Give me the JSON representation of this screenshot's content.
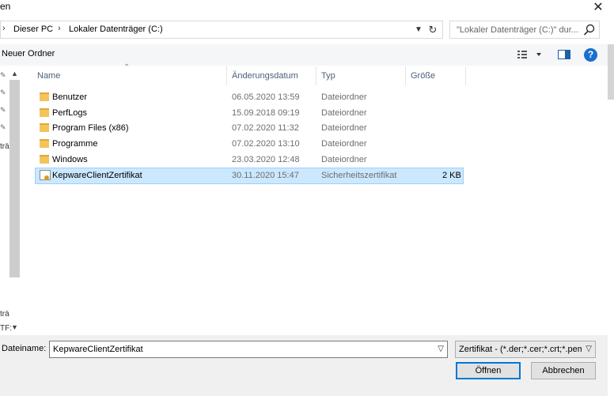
{
  "window": {
    "title": "en",
    "close_icon": "close-icon"
  },
  "address": {
    "crumbs": [
      "Dieser PC",
      "Lokaler Datenträger (C:)"
    ],
    "separator": "›"
  },
  "search": {
    "placeholder": "\"Lokaler Datenträger (C:)\" dur..."
  },
  "toolbar": {
    "new_folder": "Neuer Ordner",
    "help": "?"
  },
  "nav": {
    "labels": [
      "trä",
      "trä",
      "TF:"
    ]
  },
  "columns": {
    "name": "Name",
    "date": "Änderungsdatum",
    "type": "Typ",
    "size": "Größe"
  },
  "files": [
    {
      "name": "Benutzer",
      "date": "06.05.2020 13:59",
      "type": "Dateiordner",
      "size": "",
      "icon": "folder-icon"
    },
    {
      "name": "PerfLogs",
      "date": "15.09.2018 09:19",
      "type": "Dateiordner",
      "size": "",
      "icon": "folder-icon"
    },
    {
      "name": "Program Files (x86)",
      "date": "07.02.2020 11:32",
      "type": "Dateiordner",
      "size": "",
      "icon": "folder-icon"
    },
    {
      "name": "Programme",
      "date": "07.02.2020 13:10",
      "type": "Dateiordner",
      "size": "",
      "icon": "folder-icon"
    },
    {
      "name": "Windows",
      "date": "23.03.2020 12:48",
      "type": "Dateiordner",
      "size": "",
      "icon": "folder-icon"
    },
    {
      "name": "KepwareClientZertifikat",
      "date": "30.11.2020 15:47",
      "type": "Sicherheitszertifikat",
      "size": "2 KB",
      "icon": "certificate-icon",
      "selected": true
    }
  ],
  "footer": {
    "filename_label": "Dateiname:",
    "filename_value": "KepwareClientZertifikat",
    "filetype_value": "Zertifikat -  (*.der;*.cer;*.crt;*.pem)",
    "open_label": "Öffnen",
    "cancel_label": "Abbrechen"
  },
  "colors": {
    "selection": "#cce8ff",
    "selection_border": "#99d1ff",
    "accent": "#0078d7"
  }
}
